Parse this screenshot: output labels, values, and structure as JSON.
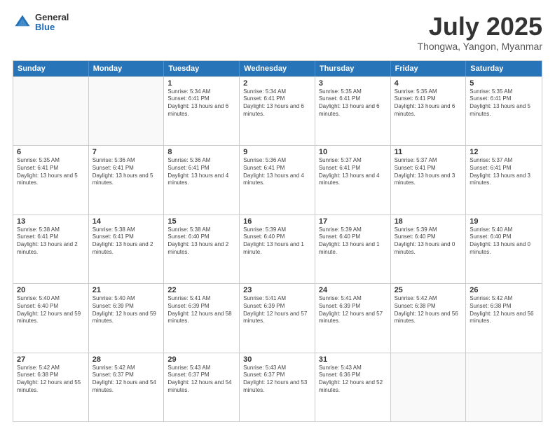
{
  "header": {
    "logo": {
      "general": "General",
      "blue": "Blue"
    },
    "title": "July 2025",
    "subtitle": "Thongwa, Yangon, Myanmar"
  },
  "days_of_week": [
    "Sunday",
    "Monday",
    "Tuesday",
    "Wednesday",
    "Thursday",
    "Friday",
    "Saturday"
  ],
  "weeks": [
    [
      {
        "day": "",
        "empty": true
      },
      {
        "day": "",
        "empty": true
      },
      {
        "day": "1",
        "sunrise": "Sunrise: 5:34 AM",
        "sunset": "Sunset: 6:41 PM",
        "daylight": "Daylight: 13 hours and 6 minutes."
      },
      {
        "day": "2",
        "sunrise": "Sunrise: 5:34 AM",
        "sunset": "Sunset: 6:41 PM",
        "daylight": "Daylight: 13 hours and 6 minutes."
      },
      {
        "day": "3",
        "sunrise": "Sunrise: 5:35 AM",
        "sunset": "Sunset: 6:41 PM",
        "daylight": "Daylight: 13 hours and 6 minutes."
      },
      {
        "day": "4",
        "sunrise": "Sunrise: 5:35 AM",
        "sunset": "Sunset: 6:41 PM",
        "daylight": "Daylight: 13 hours and 6 minutes."
      },
      {
        "day": "5",
        "sunrise": "Sunrise: 5:35 AM",
        "sunset": "Sunset: 6:41 PM",
        "daylight": "Daylight: 13 hours and 5 minutes."
      }
    ],
    [
      {
        "day": "6",
        "sunrise": "Sunrise: 5:35 AM",
        "sunset": "Sunset: 6:41 PM",
        "daylight": "Daylight: 13 hours and 5 minutes."
      },
      {
        "day": "7",
        "sunrise": "Sunrise: 5:36 AM",
        "sunset": "Sunset: 6:41 PM",
        "daylight": "Daylight: 13 hours and 5 minutes."
      },
      {
        "day": "8",
        "sunrise": "Sunrise: 5:36 AM",
        "sunset": "Sunset: 6:41 PM",
        "daylight": "Daylight: 13 hours and 4 minutes."
      },
      {
        "day": "9",
        "sunrise": "Sunrise: 5:36 AM",
        "sunset": "Sunset: 6:41 PM",
        "daylight": "Daylight: 13 hours and 4 minutes."
      },
      {
        "day": "10",
        "sunrise": "Sunrise: 5:37 AM",
        "sunset": "Sunset: 6:41 PM",
        "daylight": "Daylight: 13 hours and 4 minutes."
      },
      {
        "day": "11",
        "sunrise": "Sunrise: 5:37 AM",
        "sunset": "Sunset: 6:41 PM",
        "daylight": "Daylight: 13 hours and 3 minutes."
      },
      {
        "day": "12",
        "sunrise": "Sunrise: 5:37 AM",
        "sunset": "Sunset: 6:41 PM",
        "daylight": "Daylight: 13 hours and 3 minutes."
      }
    ],
    [
      {
        "day": "13",
        "sunrise": "Sunrise: 5:38 AM",
        "sunset": "Sunset: 6:41 PM",
        "daylight": "Daylight: 13 hours and 2 minutes."
      },
      {
        "day": "14",
        "sunrise": "Sunrise: 5:38 AM",
        "sunset": "Sunset: 6:41 PM",
        "daylight": "Daylight: 13 hours and 2 minutes."
      },
      {
        "day": "15",
        "sunrise": "Sunrise: 5:38 AM",
        "sunset": "Sunset: 6:40 PM",
        "daylight": "Daylight: 13 hours and 2 minutes."
      },
      {
        "day": "16",
        "sunrise": "Sunrise: 5:39 AM",
        "sunset": "Sunset: 6:40 PM",
        "daylight": "Daylight: 13 hours and 1 minute."
      },
      {
        "day": "17",
        "sunrise": "Sunrise: 5:39 AM",
        "sunset": "Sunset: 6:40 PM",
        "daylight": "Daylight: 13 hours and 1 minute."
      },
      {
        "day": "18",
        "sunrise": "Sunrise: 5:39 AM",
        "sunset": "Sunset: 6:40 PM",
        "daylight": "Daylight: 13 hours and 0 minutes."
      },
      {
        "day": "19",
        "sunrise": "Sunrise: 5:40 AM",
        "sunset": "Sunset: 6:40 PM",
        "daylight": "Daylight: 13 hours and 0 minutes."
      }
    ],
    [
      {
        "day": "20",
        "sunrise": "Sunrise: 5:40 AM",
        "sunset": "Sunset: 6:40 PM",
        "daylight": "Daylight: 12 hours and 59 minutes."
      },
      {
        "day": "21",
        "sunrise": "Sunrise: 5:40 AM",
        "sunset": "Sunset: 6:39 PM",
        "daylight": "Daylight: 12 hours and 59 minutes."
      },
      {
        "day": "22",
        "sunrise": "Sunrise: 5:41 AM",
        "sunset": "Sunset: 6:39 PM",
        "daylight": "Daylight: 12 hours and 58 minutes."
      },
      {
        "day": "23",
        "sunrise": "Sunrise: 5:41 AM",
        "sunset": "Sunset: 6:39 PM",
        "daylight": "Daylight: 12 hours and 57 minutes."
      },
      {
        "day": "24",
        "sunrise": "Sunrise: 5:41 AM",
        "sunset": "Sunset: 6:39 PM",
        "daylight": "Daylight: 12 hours and 57 minutes."
      },
      {
        "day": "25",
        "sunrise": "Sunrise: 5:42 AM",
        "sunset": "Sunset: 6:38 PM",
        "daylight": "Daylight: 12 hours and 56 minutes."
      },
      {
        "day": "26",
        "sunrise": "Sunrise: 5:42 AM",
        "sunset": "Sunset: 6:38 PM",
        "daylight": "Daylight: 12 hours and 56 minutes."
      }
    ],
    [
      {
        "day": "27",
        "sunrise": "Sunrise: 5:42 AM",
        "sunset": "Sunset: 6:38 PM",
        "daylight": "Daylight: 12 hours and 55 minutes."
      },
      {
        "day": "28",
        "sunrise": "Sunrise: 5:42 AM",
        "sunset": "Sunset: 6:37 PM",
        "daylight": "Daylight: 12 hours and 54 minutes."
      },
      {
        "day": "29",
        "sunrise": "Sunrise: 5:43 AM",
        "sunset": "Sunset: 6:37 PM",
        "daylight": "Daylight: 12 hours and 54 minutes."
      },
      {
        "day": "30",
        "sunrise": "Sunrise: 5:43 AM",
        "sunset": "Sunset: 6:37 PM",
        "daylight": "Daylight: 12 hours and 53 minutes."
      },
      {
        "day": "31",
        "sunrise": "Sunrise: 5:43 AM",
        "sunset": "Sunset: 6:36 PM",
        "daylight": "Daylight: 12 hours and 52 minutes."
      },
      {
        "day": "",
        "empty": true
      },
      {
        "day": "",
        "empty": true
      }
    ]
  ]
}
